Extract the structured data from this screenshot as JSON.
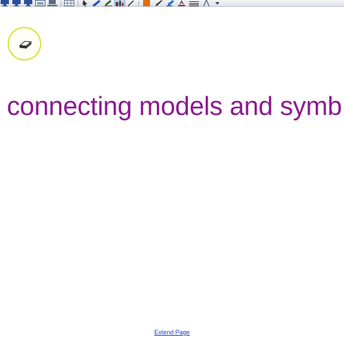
{
  "toolbar": {
    "buttons": [
      {
        "name": "display-icon-1",
        "color": "#2a4f9e"
      },
      {
        "name": "display-icon-2",
        "color": "#2a4f9e"
      },
      {
        "name": "display-icon-3",
        "color": "#2a4f9e"
      },
      {
        "name": "image-icon",
        "color": "#5d6c83"
      },
      {
        "name": "screen-capture-icon",
        "color": "#5d6c83"
      },
      {
        "name": "table-icon",
        "color": "#6b7a8f"
      },
      {
        "name": "select-pointer-icon",
        "color": "#2b2b2b"
      },
      {
        "name": "pen-icon",
        "color": "#1b4fb8"
      },
      {
        "name": "creative-pen-icon",
        "color": "#c04545"
      },
      {
        "name": "eraser-tool-icon",
        "color": "#4a4a4a",
        "active": true
      },
      {
        "name": "line-icon",
        "color": "#2b2b2b"
      },
      {
        "name": "shapes-icon",
        "color": "#e36d12"
      },
      {
        "name": "fill-icon",
        "color": "#3a3a3a"
      },
      {
        "name": "highlighter-icon",
        "color": "#2a7ad1"
      },
      {
        "name": "text-color-icon",
        "color": "#cc2020"
      },
      {
        "name": "line-style-icon",
        "color": "#2b2b2b"
      },
      {
        "name": "compass-icon",
        "color": "#5d6c83"
      },
      {
        "name": "more-options-icon",
        "color": "#444444"
      }
    ]
  },
  "cursor": {
    "icon": "eraser-cursor-icon",
    "ring_color": "#e2e23a"
  },
  "main": {
    "heading": "connecting models and symb",
    "heading_color": "#8b1a91"
  },
  "footer": {
    "extend_page_label": "Extend Page",
    "link_color": "#1a3fc4"
  }
}
